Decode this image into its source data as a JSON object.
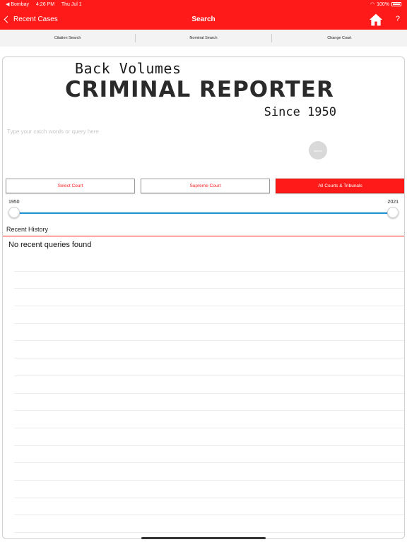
{
  "status": {
    "carrier": "◀ Bombay",
    "time": "4:26 PM",
    "date": "Thu Jul 1",
    "battery": "100%"
  },
  "nav": {
    "back_label": "Recent Cases",
    "title": "Search",
    "help": "?"
  },
  "tabs": [
    "Citation Search",
    "Nominal Search",
    "Change Court"
  ],
  "logo": {
    "line1": "Back Volumes",
    "line2": "CRIMINAL REPORTER",
    "line3": "Since 1950"
  },
  "search": {
    "placeholder": "Type your catch words or query here",
    "button": "search"
  },
  "courts": {
    "select": "Select Court",
    "supreme": "Supreme Court",
    "all": "All Courts & Tribunals",
    "selected": "All Courts & Tribunals"
  },
  "year_range": {
    "min": "1950",
    "max": "2021"
  },
  "history": {
    "title": "Recent History",
    "empty": "No recent queries found"
  },
  "colors": {
    "brand": "#ff1a1a",
    "slider": "#1e90d6"
  },
  "icons": [
    "chevron-left-icon",
    "home-icon",
    "help-icon",
    "wifi-icon",
    "battery-icon"
  ]
}
